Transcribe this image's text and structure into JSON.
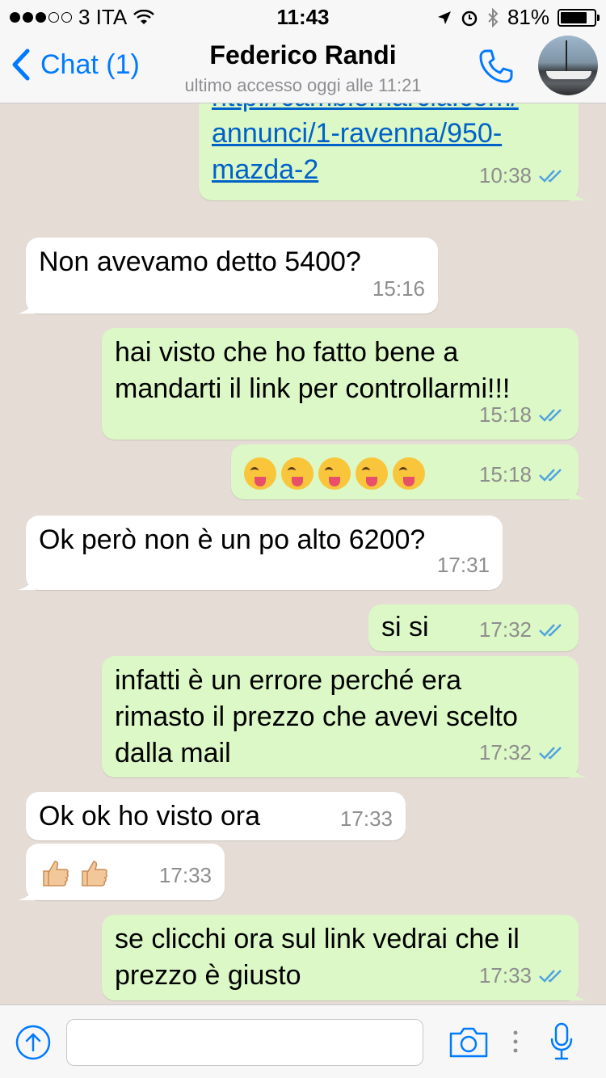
{
  "status_bar": {
    "carrier": "3 ITA",
    "time": "11:43",
    "battery": "81%"
  },
  "nav": {
    "back_label": "Chat (1)",
    "contact_name": "Federico Randi",
    "last_seen": "ultimo accesso oggi alle 11:21"
  },
  "messages": [
    {
      "direction": "out",
      "lines": [
        "http://cambiomarcia.com/",
        "annunci/1-ravenna/950-",
        "mazda-2"
      ],
      "time": "10:38",
      "is_link": true
    },
    {
      "direction": "in",
      "lines": [
        "Non avevamo detto 5400?"
      ],
      "time": "15:16"
    },
    {
      "direction": "out",
      "lines": [
        "hai visto che ho fatto bene a",
        "mandarti il link per controllarmi!!!"
      ],
      "time": "15:18"
    },
    {
      "direction": "out",
      "emoji": "face-with-stuck-out-tongue-winking-eye",
      "emoji_count": 5,
      "time": "15:18"
    },
    {
      "direction": "in",
      "lines": [
        "Ok però non è un po alto 6200?"
      ],
      "time": "17:31"
    },
    {
      "direction": "out",
      "lines": [
        "si si"
      ],
      "time": "17:32"
    },
    {
      "direction": "out",
      "lines": [
        "infatti è un errore perché era",
        "rimasto il prezzo che avevi scelto",
        "dalla mail"
      ],
      "time": "17:32"
    },
    {
      "direction": "in",
      "lines": [
        "Ok ok ho visto ora"
      ],
      "time": "17:33"
    },
    {
      "direction": "in",
      "emoji": "thumbs-up",
      "emoji_count": 2,
      "time": "17:33"
    },
    {
      "direction": "out",
      "lines": [
        "se clicchi ora sul link vedrai che il",
        "prezzo è giusto"
      ],
      "time": "17:33"
    }
  ],
  "input": {
    "placeholder": ""
  },
  "colors": {
    "accent": "#007aff",
    "outgoing_bubble": "#dcf8c6",
    "incoming_bubble": "#ffffff",
    "chat_background": "#e5ddd5",
    "read_ticks": "#4fa3e0"
  }
}
